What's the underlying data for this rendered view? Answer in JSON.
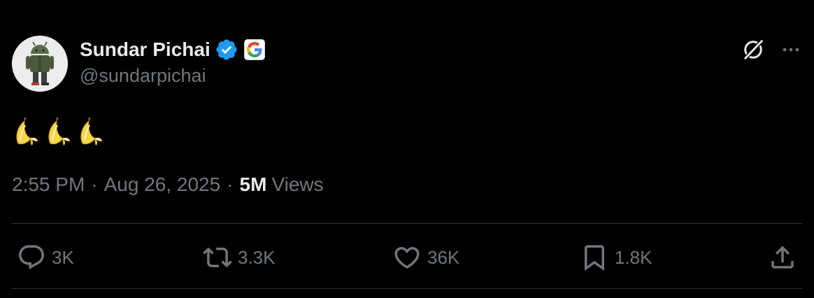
{
  "author": {
    "display_name": "Sundar Pichai",
    "handle": "@sundarpichai",
    "verified_icon": "verified-badge-icon",
    "affiliation_icon": "google-g-icon",
    "verified_color": "#1d9bf0"
  },
  "header_actions": {
    "grok_icon": "grok-icon",
    "more_icon": "more-dots-icon"
  },
  "tweet": {
    "text_icons": [
      "banana-icon",
      "banana-icon",
      "banana-icon"
    ]
  },
  "meta": {
    "time": "2:55 PM",
    "separator": "·",
    "date": "Aug 26, 2025",
    "views_count": "5M",
    "views_label": "Views"
  },
  "actions": {
    "reply": {
      "icon": "reply-icon",
      "count": "3K"
    },
    "repost": {
      "icon": "repost-icon",
      "count": "3.3K"
    },
    "like": {
      "icon": "heart-icon",
      "count": "36K"
    },
    "bookmark": {
      "icon": "bookmark-icon",
      "count": "1.8K"
    },
    "share": {
      "icon": "share-icon"
    }
  },
  "colors": {
    "background": "#000000",
    "text_primary": "#e7e9ea",
    "text_secondary": "#71767b",
    "divider": "#2f3336"
  }
}
